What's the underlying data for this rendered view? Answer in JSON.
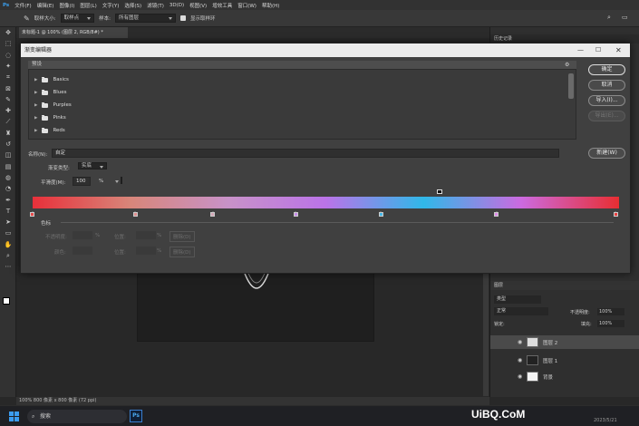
{
  "menubar": {
    "items": [
      "文件(F)",
      "编辑(E)",
      "图像(I)",
      "图层(L)",
      "文字(Y)",
      "选择(S)",
      "滤镜(T)",
      "3D(D)",
      "视图(V)",
      "增效工具",
      "窗口(W)",
      "帮助(H)"
    ]
  },
  "options": {
    "sample_size_label": "取样大小:",
    "sample_size_value": "取样点",
    "sample_label": "样本:",
    "sample_value": "所有图层",
    "show_ring_label": "显示取样环"
  },
  "document": {
    "tab_title": "未标题-1 @ 100% (图层 2, RGB/8#) *"
  },
  "dialog": {
    "title": "渐变编辑器",
    "preset_header": "预设",
    "presets": [
      "Basics",
      "Blues",
      "Purples",
      "Pinks",
      "Reds"
    ],
    "buttons": {
      "ok": "确定",
      "cancel": "取消",
      "import": "导入(I)...",
      "export": "导出(E)...",
      "new": "新建(W)"
    },
    "name_label": "名称(N):",
    "name_value": "自定",
    "type_label": "渐变类型:",
    "type_value": "实底",
    "smooth_label": "平滑度(M):",
    "smooth_value": "100",
    "smooth_unit": "%",
    "stops_label": "色标",
    "opacity_label": "不透明度:",
    "opacity_unit": "%",
    "location_label": "位置:",
    "location_unit": "%",
    "delete_label": "删除(D)",
    "color_label": "颜色:",
    "gradient_colors": [
      "#e8303a",
      "#d8867a",
      "#c892c8",
      "#bb73e8",
      "#30b8e8",
      "#cc6ae0",
      "#e82e32"
    ],
    "color_stop_colors": [
      "#e84a4a",
      "#e08f8f",
      "#d4a8b8",
      "#c68ee8",
      "#45b9e8",
      "#dd8ee8",
      "#e84040"
    ]
  },
  "history_panel": {
    "title": "历史记录"
  },
  "layers_panel": {
    "title": "图层",
    "kind": "类型",
    "blend_mode": "正常",
    "opacity_label": "不透明度:",
    "opacity_value": "100%",
    "lock_label": "锁定:",
    "fill_label": "填充:",
    "fill_value": "100%",
    "layers": [
      "图层 2",
      "图层 1",
      "背景"
    ]
  },
  "status": {
    "text": "100%    800 像素 x 800 像素 (72 ppi)"
  },
  "taskbar": {
    "search_placeholder": "搜索"
  },
  "watermark": {
    "text": "UiBQ.CoM",
    "date": "2023/5/21"
  }
}
